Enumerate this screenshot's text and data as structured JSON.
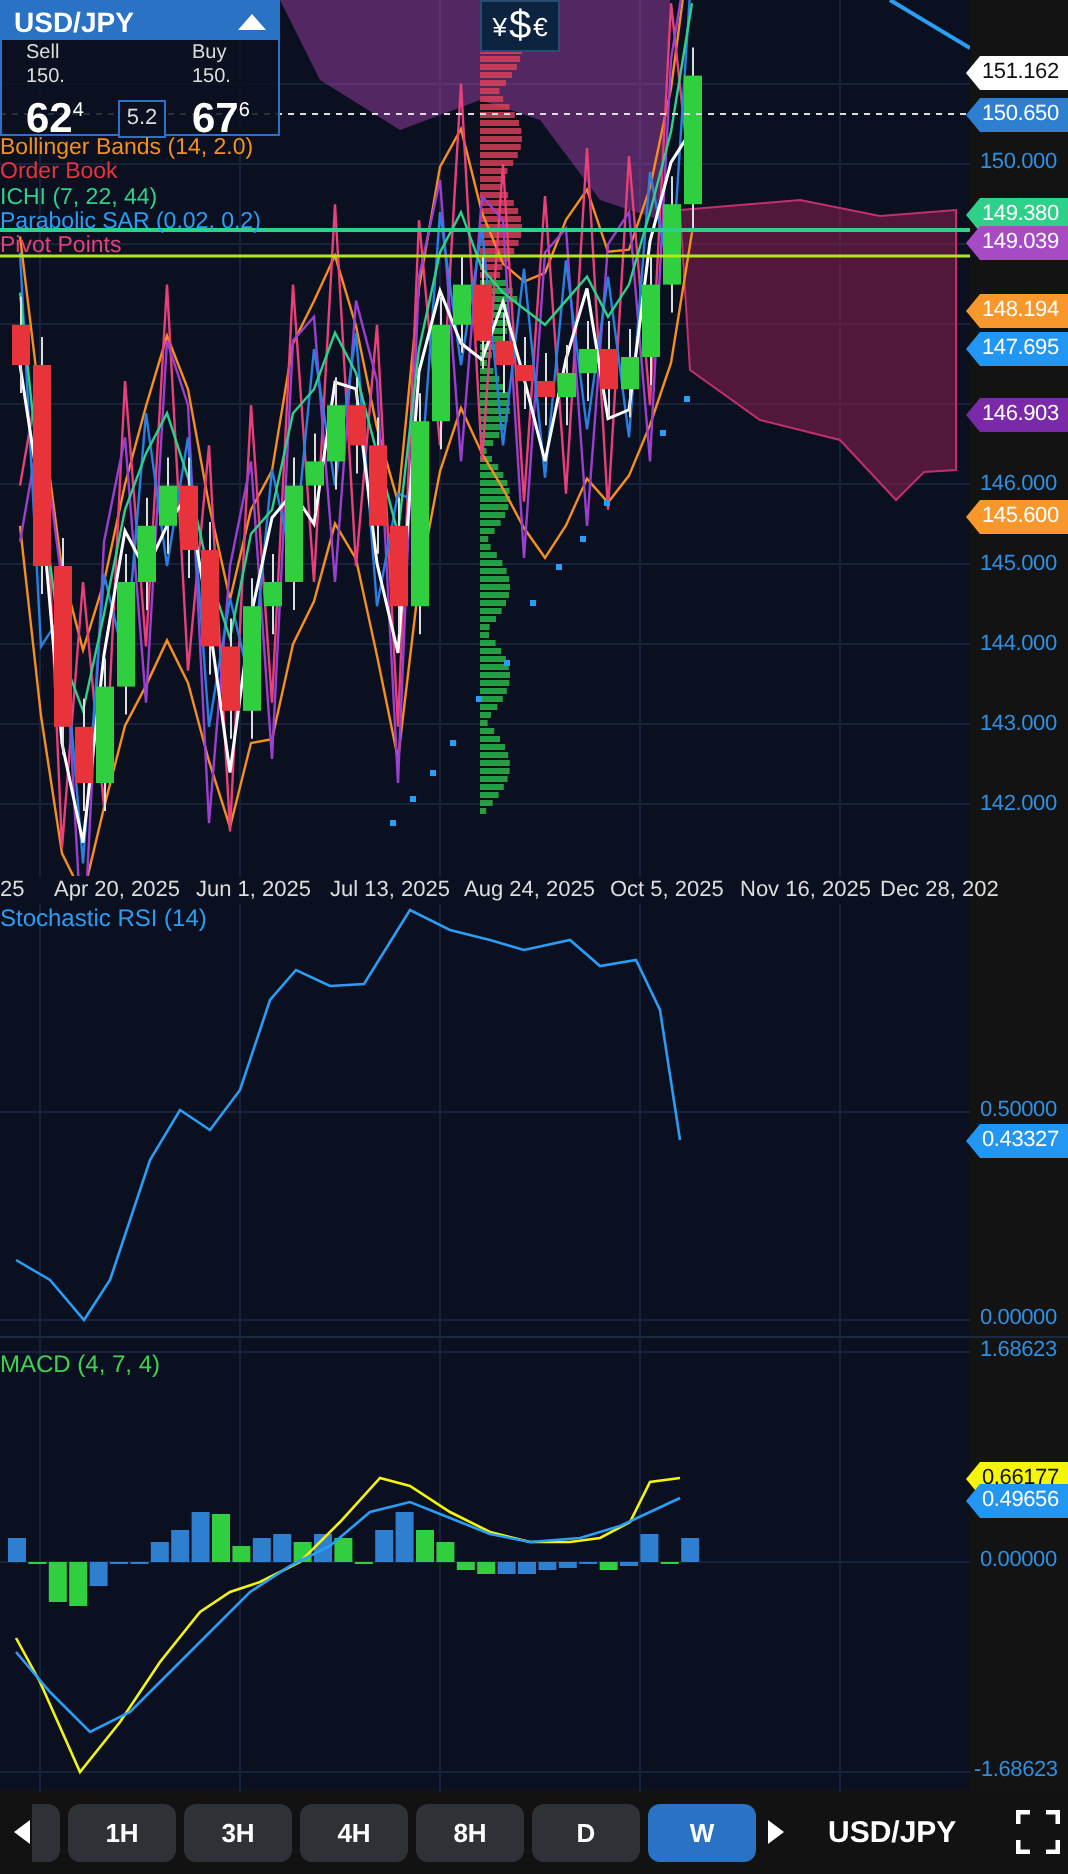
{
  "quote": {
    "symbol": "USD/JPY",
    "expanded": true,
    "sell": {
      "label": "Sell",
      "big_figure": "150.",
      "pips": "62$^{4}$"
    },
    "spread": "5.2",
    "buy": {
      "label": "Buy",
      "big_figure": "150.",
      "pips": "67$^{6}$"
    }
  },
  "currency_button": {
    "symbols": [
      "¥",
      "$",
      "€"
    ]
  },
  "legend": [
    {
      "label": "Bollinger Bands (14, 2.0)",
      "color": "#f5901e"
    },
    {
      "label": "Order Book",
      "color": "#e8333f"
    },
    {
      "label": "ICHI (7, 22, 44)",
      "color": "#2ed08a"
    },
    {
      "label": "Parabolic SAR (0.02, 0.2)",
      "color": "#2a9df4"
    },
    {
      "label": "Pivot Points",
      "color": "#e8407a"
    }
  ],
  "price_axis": {
    "ticks": [
      "150.000",
      "146.000",
      "145.000",
      "144.000",
      "143.000",
      "142.000"
    ],
    "tags": [
      {
        "value": "151.162",
        "color": "#ffffff"
      },
      {
        "value": "150.650",
        "color": "#2f7fd0"
      },
      {
        "value": "149.380",
        "color": "#2ed08a"
      },
      {
        "value": "149.039",
        "color": "#a64bc4"
      },
      {
        "value": "148.194",
        "color": "#f7972c"
      },
      {
        "value": "147.695",
        "color": "#2196f3"
      },
      {
        "value": "146.903",
        "color": "#7a2aa8"
      },
      {
        "value": "145.600",
        "color": "#f7972c"
      }
    ]
  },
  "time_axis": {
    "labels": [
      "25",
      "Apr 20, 2025",
      "Jun 1, 2025",
      "Jul 13, 2025",
      "Aug 24, 2025",
      "Oct 5, 2025",
      "Nov 16, 2025",
      "Dec 28, 202"
    ]
  },
  "stochastic_rsi": {
    "title": "Stochastic RSI (14)",
    "ticks": [
      "0.50000",
      "0.00000"
    ],
    "tags": [
      {
        "value": "0.43327",
        "color": "#2196f3"
      }
    ]
  },
  "macd": {
    "title": "MACD (4, 7, 4)",
    "ticks": [
      "1.68623",
      "0.00000",
      "-1.68623"
    ],
    "tags": [
      {
        "value": "0.66177",
        "color": "#f5f50a"
      },
      {
        "value": "0.49656",
        "color": "#2196f3"
      }
    ]
  },
  "timeframes": [
    {
      "label": "1H",
      "selected": false
    },
    {
      "label": "3H",
      "selected": false
    },
    {
      "label": "4H",
      "selected": false
    },
    {
      "label": "8H",
      "selected": false
    },
    {
      "label": "D",
      "selected": false
    },
    {
      "label": "W",
      "selected": true
    }
  ],
  "symbol": "USD/JPY"
}
